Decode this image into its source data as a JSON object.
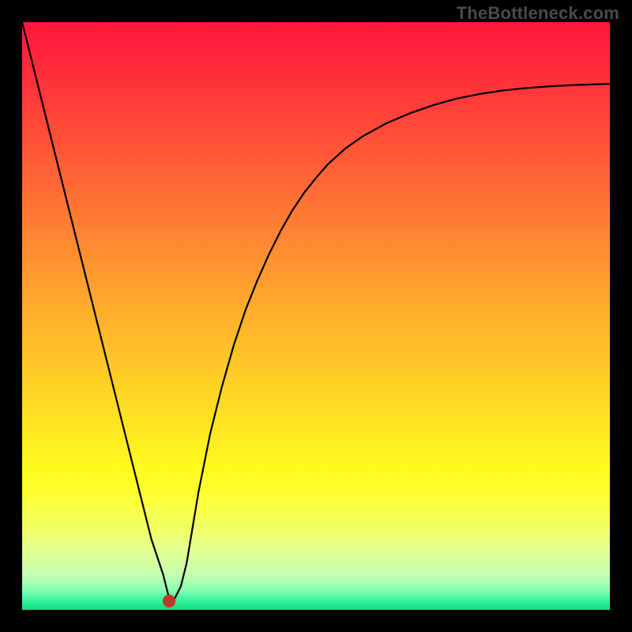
{
  "watermark": "TheBottleneck.com",
  "chart_data": {
    "type": "line",
    "title": "",
    "xlabel": "",
    "ylabel": "",
    "xlim": [
      0,
      100
    ],
    "ylim": [
      0,
      100
    ],
    "grid": false,
    "background_gradient": [
      {
        "offset": 0.0,
        "color": "#ff163b"
      },
      {
        "offset": 0.08,
        "color": "#ff2b3a"
      },
      {
        "offset": 0.18,
        "color": "#ff4a38"
      },
      {
        "offset": 0.28,
        "color": "#ff6a35"
      },
      {
        "offset": 0.38,
        "color": "#ff8a31"
      },
      {
        "offset": 0.48,
        "color": "#ffaa2d"
      },
      {
        "offset": 0.58,
        "color": "#ffc728"
      },
      {
        "offset": 0.68,
        "color": "#ffe322"
      },
      {
        "offset": 0.76,
        "color": "#fffb1e"
      },
      {
        "offset": 0.8,
        "color": "#fdff2e"
      },
      {
        "offset": 0.86,
        "color": "#f2ff63"
      },
      {
        "offset": 0.9,
        "color": "#e2ff91"
      },
      {
        "offset": 0.94,
        "color": "#c5ffb1"
      },
      {
        "offset": 0.965,
        "color": "#8affb3"
      },
      {
        "offset": 0.985,
        "color": "#33f39a"
      },
      {
        "offset": 1.0,
        "color": "#11da7e"
      }
    ],
    "series": [
      {
        "name": "bottleneck-curve",
        "color": "#000000",
        "x": [
          0,
          2,
          4,
          6,
          8,
          10,
          12,
          14,
          16,
          18,
          20,
          22,
          24,
          25,
          26,
          27,
          28,
          29,
          30,
          32,
          34,
          36,
          38,
          40,
          42,
          44,
          46,
          48,
          50,
          52,
          55,
          58,
          62,
          66,
          70,
          74,
          78,
          82,
          86,
          90,
          94,
          97,
          100
        ],
        "y": [
          100,
          92,
          84,
          76,
          68,
          60,
          52,
          44,
          36,
          28,
          20,
          12,
          6,
          2,
          2,
          4,
          8,
          14,
          20,
          30,
          38,
          45,
          51,
          56,
          60.5,
          64.5,
          68,
          71,
          73.5,
          75.8,
          78.5,
          80.6,
          82.8,
          84.5,
          85.9,
          87,
          87.8,
          88.4,
          88.8,
          89.1,
          89.3,
          89.4,
          89.5
        ]
      }
    ],
    "marker": {
      "x": 25,
      "y": 1.5,
      "color": "#c0392b",
      "r": 1.1
    }
  }
}
